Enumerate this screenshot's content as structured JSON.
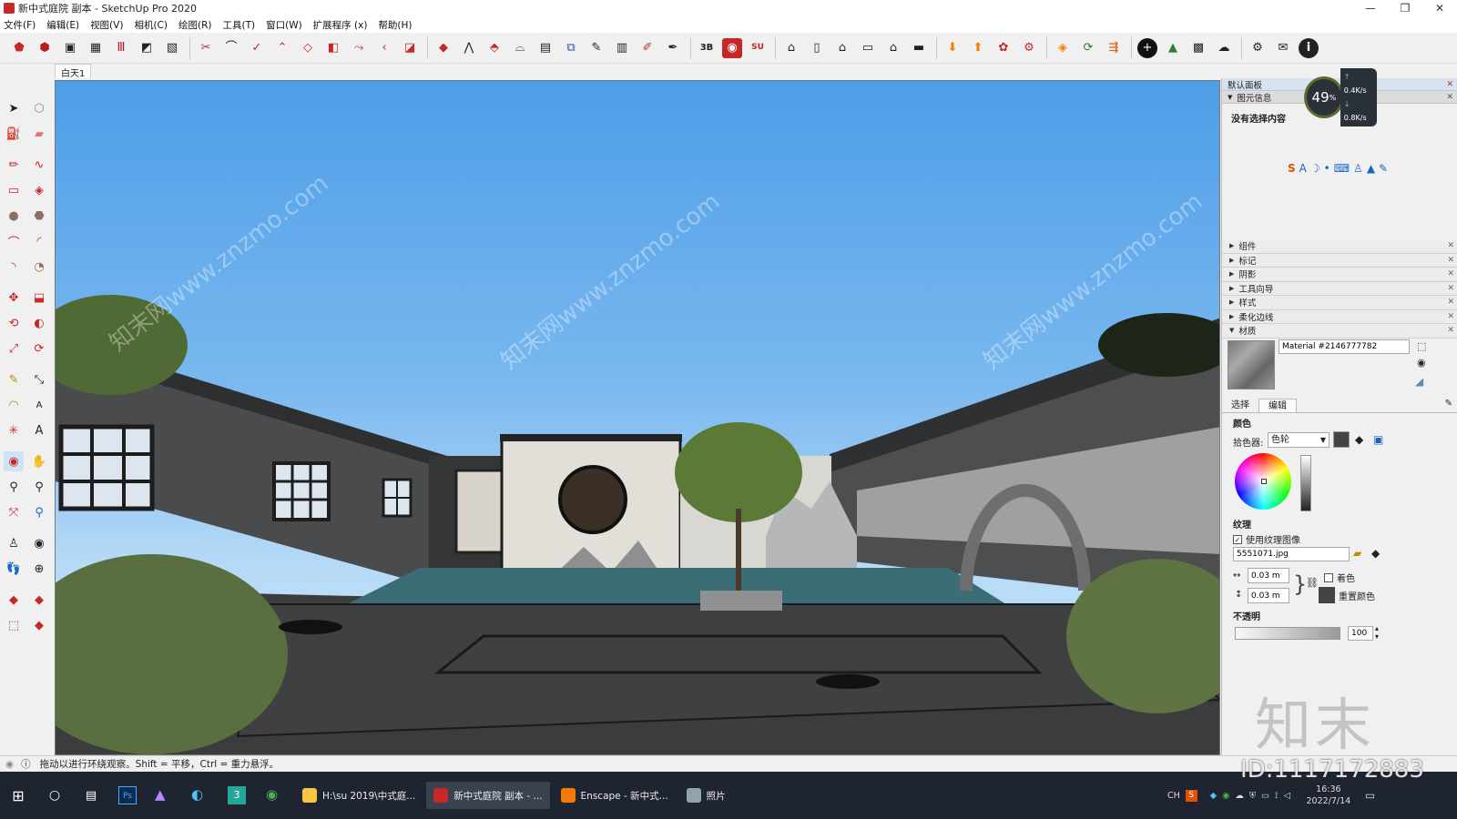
{
  "window": {
    "title": "新中式庭院 副本 - SketchUp Pro 2020"
  },
  "menu": [
    "文件(F)",
    "编辑(E)",
    "视图(V)",
    "相机(C)",
    "绘图(R)",
    "工具(T)",
    "窗口(W)",
    "扩展程序 (x)",
    "帮助(H)"
  ],
  "scene_tab": "白天1",
  "panel": {
    "title": "默认面板",
    "entity_info": "图元信息",
    "no_selection": "没有选择内容",
    "perf_percent": "49",
    "perf_unit": "%",
    "net_up": "0.4",
    "net_down": "0.8",
    "net_unit": "K/s",
    "trays": [
      "组件",
      "标记",
      "阴影",
      "工具向导",
      "样式",
      "柔化边线"
    ],
    "materials_label": "材质",
    "material_name": "Material #2146777782",
    "tab_select": "选择",
    "tab_edit": "编辑",
    "color_label": "颜色",
    "picker_label": "拾色器:",
    "picker_value": "色轮",
    "texture_label": "纹理",
    "use_texture": "使用纹理图像",
    "texture_file": "5551071.jpg",
    "width_value": "0.03 m",
    "height_value": "0.03 m",
    "colorize_label": "着色",
    "reset_color": "重置颜色",
    "opacity_label": "不透明",
    "opacity_value": "100"
  },
  "status": {
    "hint": "拖动以进行环绕观察。Shift = 平移，Ctrl = 重力悬浮。"
  },
  "watermarks": {
    "brand": "知末",
    "id": "ID:1117172883",
    "site": "知末网www.znzmo.com"
  },
  "taskbar": {
    "items": [
      "H:\\su 2019\\中式庭...",
      "新中式庭院 副本 - ...",
      "Enscape - 新中式...",
      "照片"
    ],
    "tray_ime": "CH",
    "time": "16:36",
    "date": "2022/7/14"
  },
  "colors": {
    "sky_top": "#4d9ee8",
    "wall": "#505152",
    "accent_red": "#c62828",
    "taskbar": "#1e2530"
  }
}
